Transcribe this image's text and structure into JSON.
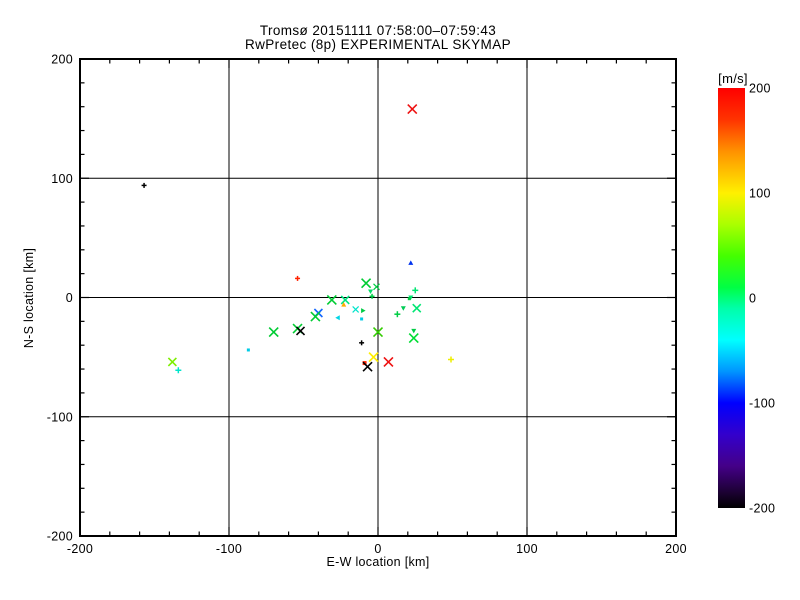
{
  "window": {
    "background": "#ffffff",
    "foreground": "#000000"
  },
  "chart_data": {
    "type": "scatter",
    "title_line1": "Tromsø 20151111 07:58:00–07:59:43",
    "title_line2": "RwPretec (8p) EXPERIMENTAL SKYMAP",
    "xlabel": "E-W location [km]",
    "ylabel": "N-S location [km]",
    "xlim": [
      -200,
      200
    ],
    "ylim": [
      -200,
      200
    ],
    "xticks": [
      -200,
      -100,
      0,
      100,
      200
    ],
    "yticks": [
      -200,
      -100,
      0,
      100,
      200
    ],
    "minor_tick_step": 20,
    "grid": true,
    "grid_positions": [
      -100,
      0,
      100
    ],
    "axis_color": "#000000",
    "points": [
      {
        "x": 23,
        "y": 158,
        "marker": "x",
        "color": "#ee1111",
        "size": 9
      },
      {
        "x": -157,
        "y": 94,
        "marker": "plus",
        "color": "#000000",
        "size": 5
      },
      {
        "x": -54,
        "y": 16,
        "marker": "plus",
        "color": "#ff2200",
        "size": 5
      },
      {
        "x": 22,
        "y": 29,
        "marker": "tri-up",
        "color": "#0033ee",
        "size": 5
      },
      {
        "x": -8,
        "y": 12,
        "marker": "x",
        "color": "#00cc33",
        "size": 9
      },
      {
        "x": -1,
        "y": 9,
        "marker": "x",
        "color": "#00cc44",
        "size": 6
      },
      {
        "x": -5,
        "y": 5,
        "marker": "tri-down",
        "color": "#00dd66",
        "size": 5
      },
      {
        "x": -4,
        "y": 1,
        "marker": "plus",
        "color": "#00cc44",
        "size": 5
      },
      {
        "x": 22,
        "y": 0,
        "marker": "tri-down",
        "color": "#00e673",
        "size": 5
      },
      {
        "x": 25,
        "y": 6,
        "marker": "plus",
        "color": "#00e673",
        "size": 6
      },
      {
        "x": 21,
        "y": -1,
        "marker": "dot",
        "color": "#00cc44",
        "size": 3
      },
      {
        "x": -31,
        "y": -2,
        "marker": "x",
        "color": "#00cc33",
        "size": 9
      },
      {
        "x": -22,
        "y": -2,
        "marker": "x",
        "color": "#00e680",
        "size": 8
      },
      {
        "x": -23,
        "y": -6,
        "marker": "tri-up",
        "color": "#ffaa00",
        "size": 5
      },
      {
        "x": -40,
        "y": -13,
        "marker": "x",
        "color": "#1166ff",
        "size": 8
      },
      {
        "x": -42,
        "y": -16,
        "marker": "x",
        "color": "#00cc33",
        "size": 9
      },
      {
        "x": -27,
        "y": -17,
        "marker": "tri-left",
        "color": "#00d5e6",
        "size": 5
      },
      {
        "x": -15,
        "y": -10,
        "marker": "x",
        "color": "#00e5cc",
        "size": 6
      },
      {
        "x": -10,
        "y": -11,
        "marker": "tri-right",
        "color": "#00cc44",
        "size": 5
      },
      {
        "x": 17,
        "y": -9,
        "marker": "tri-down",
        "color": "#00cc55",
        "size": 5
      },
      {
        "x": 26,
        "y": -9,
        "marker": "x",
        "color": "#00e673",
        "size": 8
      },
      {
        "x": 13,
        "y": -14,
        "marker": "plus",
        "color": "#00cc44",
        "size": 6
      },
      {
        "x": -11,
        "y": -18,
        "marker": "dot",
        "color": "#00cce6",
        "size": 3
      },
      {
        "x": -70,
        "y": -29,
        "marker": "x",
        "color": "#00cc33",
        "size": 9
      },
      {
        "x": -54,
        "y": -26,
        "marker": "x",
        "color": "#00cc33",
        "size": 9
      },
      {
        "x": -52,
        "y": -28,
        "marker": "x",
        "color": "#000000",
        "size": 8
      },
      {
        "x": 0,
        "y": -29,
        "marker": "x",
        "color": "#33cc00",
        "size": 9
      },
      {
        "x": 24,
        "y": -28,
        "marker": "tri-down",
        "color": "#00cc44",
        "size": 5
      },
      {
        "x": 24,
        "y": -34,
        "marker": "x",
        "color": "#00dd33",
        "size": 9
      },
      {
        "x": -11,
        "y": -38,
        "marker": "plus",
        "color": "#000000",
        "size": 5
      },
      {
        "x": -87,
        "y": -44,
        "marker": "dot",
        "color": "#00cce6",
        "size": 3
      },
      {
        "x": -3,
        "y": -50,
        "marker": "x",
        "color": "#ffee00",
        "size": 9
      },
      {
        "x": -9,
        "y": -55,
        "marker": "dot",
        "color": "#ff2200",
        "size": 4
      },
      {
        "x": -7,
        "y": -58,
        "marker": "x",
        "color": "#000000",
        "size": 9
      },
      {
        "x": 7,
        "y": -54,
        "marker": "x",
        "color": "#ee1111",
        "size": 9
      },
      {
        "x": -138,
        "y": -54,
        "marker": "x",
        "color": "#7dee00",
        "size": 8
      },
      {
        "x": -134,
        "y": -61,
        "marker": "plus",
        "color": "#00e5cc",
        "size": 6
      },
      {
        "x": 49,
        "y": -52,
        "marker": "plus",
        "color": "#eeee00",
        "size": 6
      }
    ],
    "colorbar": {
      "label": "[m/s]",
      "min": -200,
      "max": 200,
      "ticks": [
        200,
        100,
        0,
        -100,
        -200
      ],
      "gradient": [
        {
          "v": 200,
          "c": "#ff0000"
        },
        {
          "v": 170,
          "c": "#ff3300"
        },
        {
          "v": 140,
          "c": "#ff9100"
        },
        {
          "v": 100,
          "c": "#fff000"
        },
        {
          "v": 70,
          "c": "#aaff00"
        },
        {
          "v": 40,
          "c": "#44ff00"
        },
        {
          "v": 10,
          "c": "#00ff44"
        },
        {
          "v": -10,
          "c": "#00ffaa"
        },
        {
          "v": -40,
          "c": "#00ffff"
        },
        {
          "v": -70,
          "c": "#0095ff"
        },
        {
          "v": -100,
          "c": "#0000ff"
        },
        {
          "v": -130,
          "c": "#3300cc"
        },
        {
          "v": -160,
          "c": "#440088"
        },
        {
          "v": -185,
          "c": "#1c0133"
        },
        {
          "v": -200,
          "c": "#000000"
        }
      ]
    }
  }
}
